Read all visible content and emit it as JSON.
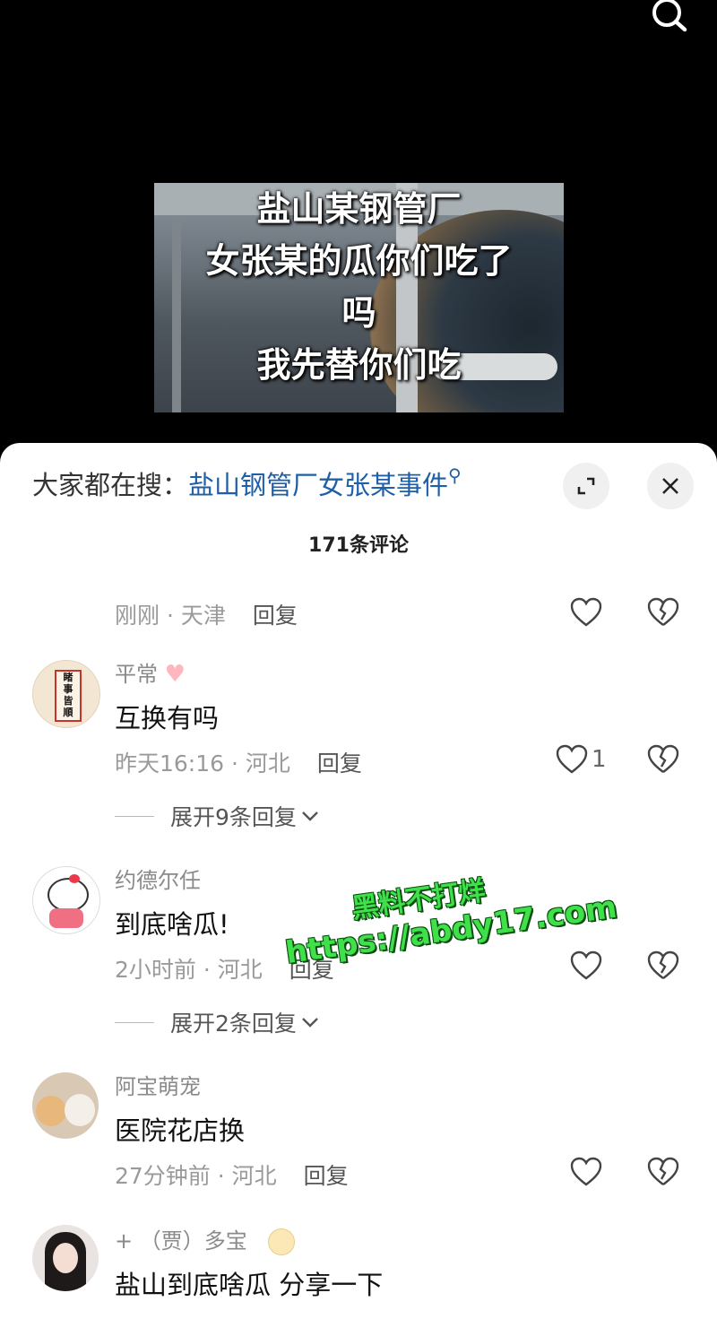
{
  "video": {
    "overlay_lines": [
      "盐山某钢管厂",
      "女张某的瓜你们吃了",
      "吗",
      "我先替你们吃"
    ]
  },
  "sheet": {
    "trending_prefix": "大家都在搜：",
    "trending_query": "盐山钢管厂女张某事件",
    "comment_count": "171条评论"
  },
  "comments": [
    {
      "meta_time": "刚刚",
      "meta_region": "天津",
      "reply": "回复",
      "likes": ""
    },
    {
      "user": "平常",
      "text": "互换有吗",
      "meta_time": "昨天16:16",
      "meta_region": "河北",
      "reply": "回复",
      "likes": "1",
      "expand": "展开9条回复"
    },
    {
      "user": "约德尔任",
      "text": "到底啥瓜!",
      "meta_time": "2小时前",
      "meta_region": "河北",
      "reply": "回复",
      "likes": "",
      "expand": "展开2条回复"
    },
    {
      "user": "阿宝萌宠",
      "text": "医院花店换",
      "meta_time": "27分钟前",
      "meta_region": "河北",
      "reply": "回复",
      "likes": ""
    },
    {
      "user": "+ （贾）多宝",
      "text": "盐山到底啥瓜  分享一下"
    }
  ],
  "watermark": {
    "line1": "黑料不打烊",
    "line2": "https://abdy17.com"
  },
  "colors": {
    "link": "#1f5fa8",
    "watermark": "#3fe04a"
  }
}
